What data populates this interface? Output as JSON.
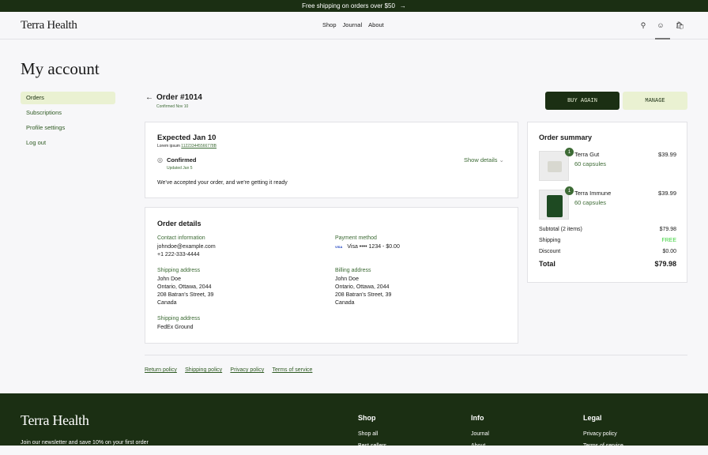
{
  "banner": {
    "text": "Free shipping on orders over $50",
    "icon": "arrow-right-icon"
  },
  "header": {
    "logo": "Terra Health",
    "nav": [
      "Shop",
      "Journal",
      "About"
    ],
    "icons": [
      "search-icon",
      "account-icon",
      "bag-icon"
    ]
  },
  "page_title": "My account",
  "sidebar": {
    "items": [
      {
        "label": "Orders",
        "active": true
      },
      {
        "label": "Subscriptions"
      },
      {
        "label": "Profile settings"
      },
      {
        "label": "Log out"
      }
    ]
  },
  "order": {
    "title": "Order #1014",
    "confirmed": "Confirmed Nov 10",
    "buy_again": "BUY AGAIN",
    "manage": "MANAGE"
  },
  "status": {
    "expected": "Expected Jan 10",
    "tracking_label": "Lorem ipsum",
    "tracking_number": "112233445566778B",
    "state": "Confirmed",
    "updated": "Updated Jan 5",
    "show_details": "Show details",
    "message": "We've accepted your order, and we're getting it ready"
  },
  "details": {
    "title": "Order details",
    "contact": {
      "label": "Contact information",
      "email": "johndoe@example.com",
      "phone": "+1 222-333-4444"
    },
    "payment": {
      "label": "Payment method",
      "card_brand": "VISA",
      "text": "Visa •••• 1234 - $0.00"
    },
    "shipping": {
      "label": "Shipping address",
      "lines": [
        "John Doe",
        "Ontario, Ottawa, 2044",
        "208 Batran's Street, 39",
        "Canada"
      ]
    },
    "billing": {
      "label": "Billing address",
      "lines": [
        "John Doe",
        "Ontario, Ottawa, 2044",
        "208 Batran's Street, 39",
        "Canada"
      ]
    },
    "method": {
      "label": "Shipping address",
      "value": "FedEx Ground"
    }
  },
  "summary": {
    "title": "Order summary",
    "items": [
      {
        "name": "Terra Gut",
        "variant": "60 capsules",
        "price": "$39.99",
        "qty": "1"
      },
      {
        "name": "Terra Immune",
        "variant": "60 capsules",
        "price": "$39.99",
        "qty": "1"
      }
    ],
    "subtotal_label": "Subtotal (2 items)",
    "subtotal": "$79.98",
    "shipping_label": "Shipping",
    "shipping": "FREE",
    "discount_label": "Discount",
    "discount": "$0.00",
    "total_label": "Total",
    "total": "$79.98"
  },
  "policies": [
    "Return policy",
    "Shipping policy",
    "Privacy policy",
    "Terms of service"
  ],
  "footer": {
    "logo": "Terra Health",
    "newsletter": "Join our newsletter and save 10% on your first order",
    "cols": [
      {
        "title": "Shop",
        "items": [
          "Shop all",
          "Best sellers"
        ]
      },
      {
        "title": "Info",
        "items": [
          "Journal",
          "About"
        ]
      },
      {
        "title": "Legal",
        "items": [
          "Privacy policy",
          "Terms of service"
        ]
      }
    ]
  },
  "colors": {
    "dark_green": "#1b2f13",
    "accent_green": "#3d6b35",
    "light_green": "#eaf1d2",
    "free": "#3bd13b"
  }
}
